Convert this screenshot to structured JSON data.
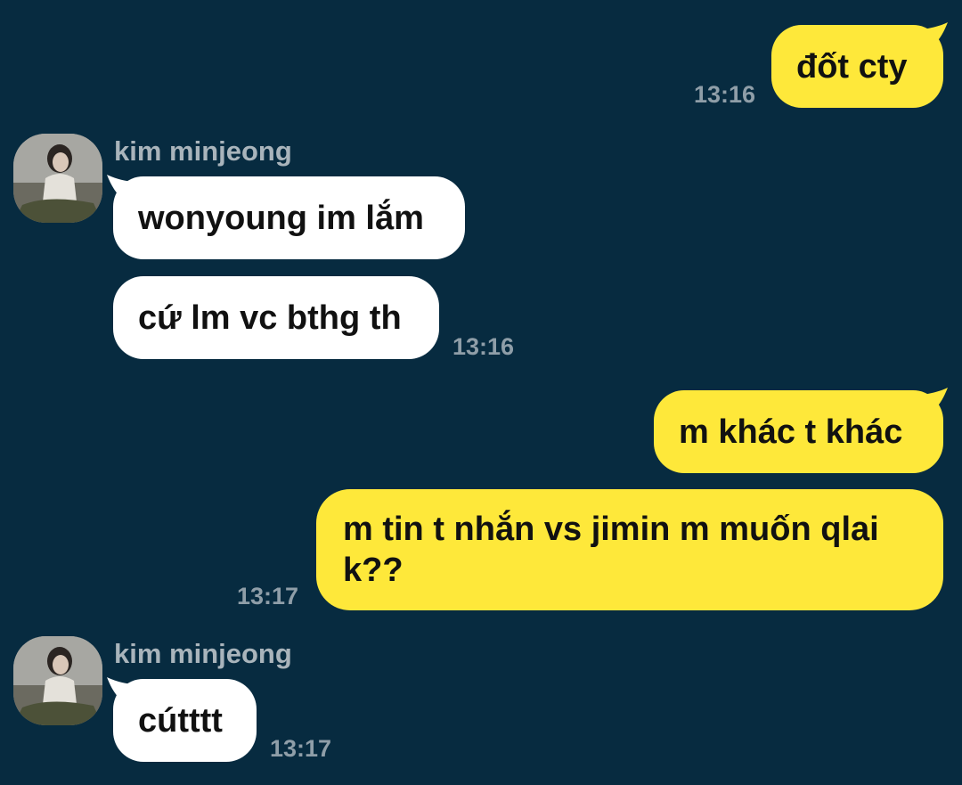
{
  "conversation": {
    "contact_name": "kim minjeong",
    "colors": {
      "background": "#072b40",
      "outgoing_bubble": "#fee83a",
      "incoming_bubble": "#ffffff",
      "timestamp": "#8f9ea8",
      "sender_name": "#a9b4bb"
    },
    "messages": [
      {
        "direction": "outgoing",
        "text": "đốt cty",
        "time": "13:16"
      },
      {
        "direction": "incoming",
        "sender": "kim minjeong",
        "avatar": "profile-photo",
        "text": "wonyoung im lắm"
      },
      {
        "direction": "incoming",
        "text": "cứ lm vc bthg th",
        "time": "13:16"
      },
      {
        "direction": "outgoing",
        "text": "m khác t khác"
      },
      {
        "direction": "outgoing",
        "text": "m tin t nhắn vs jimin m muốn qlai k??",
        "time": "13:17"
      },
      {
        "direction": "incoming",
        "sender": "kim minjeong",
        "avatar": "profile-photo",
        "text": "cútttt",
        "time": "13:17"
      }
    ]
  }
}
